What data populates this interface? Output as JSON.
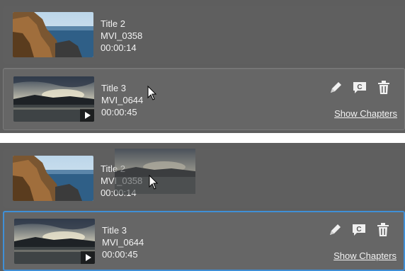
{
  "top_panel": {
    "clip_1": {
      "title": "Title 2",
      "file": "MVI_0358",
      "duration": "00:00:14",
      "thumbnail": "coastal-cliffs"
    },
    "clip_2": {
      "title": "Title 3",
      "file": "MVI_0644",
      "duration": "00:00:45",
      "thumbnail": "sunset-lake",
      "show_chapters": "Show Chapters"
    }
  },
  "bottom_panel": {
    "clip_1": {
      "title": "Title 2",
      "file": "MVI_0358",
      "duration": "00:00:14",
      "thumbnail": "coastal-cliffs"
    },
    "clip_2": {
      "title": "Title 3",
      "file": "MVI_0644",
      "duration": "00:00:45",
      "thumbnail": "sunset-lake",
      "show_chapters": "Show Chapters"
    }
  },
  "icons": [
    "pencil-icon",
    "chapter-icon",
    "trash-icon",
    "play-icon",
    "mouse-cursor-icon"
  ],
  "colors": {
    "panel_bg": "#5e5e5e",
    "selection_border": "#3f8fd6",
    "text": "#f2f2f2"
  }
}
